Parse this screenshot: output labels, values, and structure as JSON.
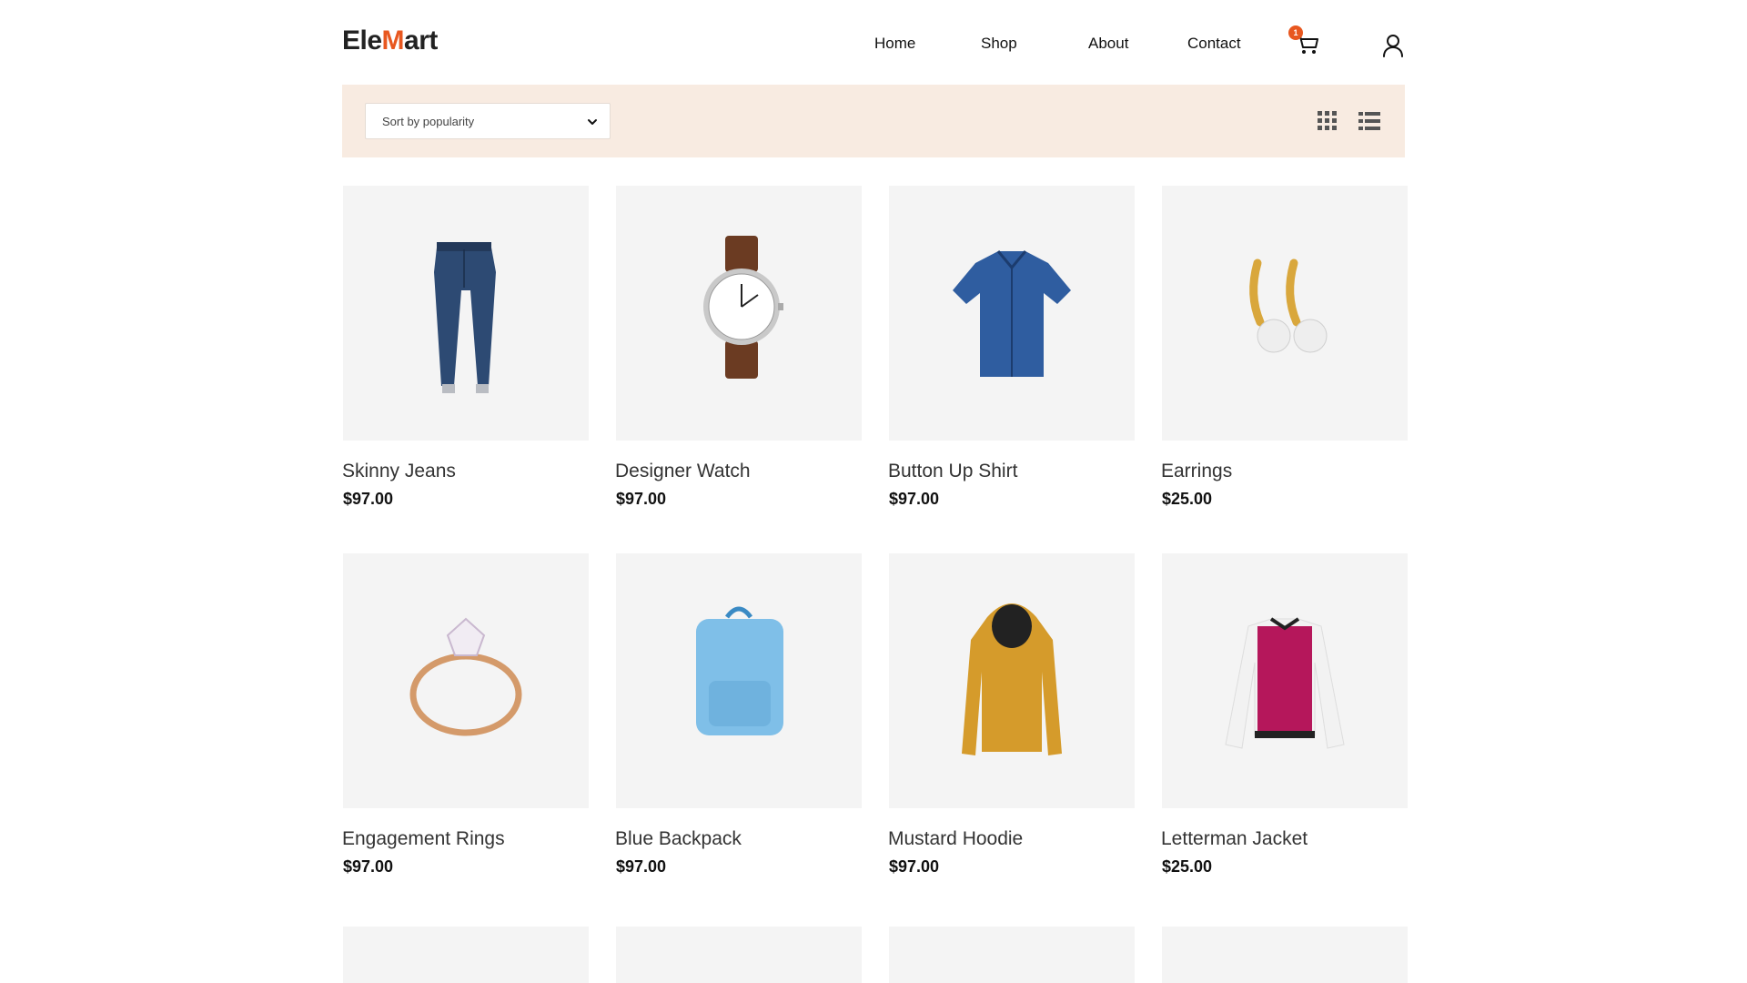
{
  "brand": {
    "logo_prefix": "Ele",
    "logo_m": "M",
    "logo_suffix": "art",
    "accent_color": "#e8571f"
  },
  "nav": {
    "items": [
      {
        "label": "Home"
      },
      {
        "label": "Shop"
      },
      {
        "label": "About"
      },
      {
        "label": "Contact"
      }
    ],
    "cart_count": "1",
    "cart_icon": "cart-icon",
    "user_icon": "user-icon"
  },
  "toolbar": {
    "sort_value": "Sort by popularity",
    "grid_view_icon": "grid-view-icon",
    "list_view_icon": "list-view-icon",
    "background": "#f8ebe1"
  },
  "products": [
    {
      "name": "Skinny Jeans",
      "price": "$97.00",
      "icon": "jeans"
    },
    {
      "name": "Designer Watch",
      "price": "$97.00",
      "icon": "watch"
    },
    {
      "name": "Button Up Shirt",
      "price": "$97.00",
      "icon": "shirt"
    },
    {
      "name": "Earrings",
      "price": "$25.00",
      "icon": "earrings"
    },
    {
      "name": "Engagement Rings",
      "price": "$97.00",
      "icon": "ring"
    },
    {
      "name": "Blue Backpack",
      "price": "$97.00",
      "icon": "backpack"
    },
    {
      "name": "Mustard Hoodie",
      "price": "$97.00",
      "icon": "hoodie"
    },
    {
      "name": "Letterman Jacket",
      "price": "$25.00",
      "icon": "jacket"
    }
  ]
}
